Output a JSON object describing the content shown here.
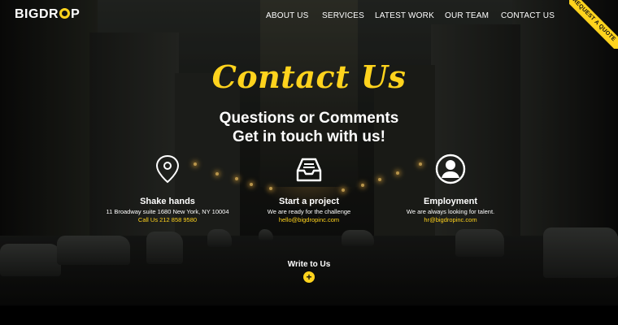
{
  "header": {
    "logo_text_a": "BIGDR",
    "logo_text_b": "P",
    "nav": [
      "ABOUT US",
      "SERVICES",
      "LATEST WORK",
      "OUR TEAM",
      "CONTACT US"
    ],
    "ribbon_label": "REQUEST A QUOTE"
  },
  "hero": {
    "title": "Contact Us",
    "subtitle_line1": "Questions or Comments",
    "subtitle_line2": "Get in touch with us!"
  },
  "columns": [
    {
      "icon": "map-pin-icon",
      "title": "Shake hands",
      "line1": "11 Broadway suite 1680 New York, NY 10004",
      "line2": "Call Us 212 858 9580"
    },
    {
      "icon": "inbox-tray-icon",
      "title": "Start a project",
      "line1": "We are ready for the challenge",
      "line2": "hello@bigdropinc.com"
    },
    {
      "icon": "user-avatar-icon",
      "title": "Employment",
      "line1": "We are always looking for talent.",
      "line2": "hr@bigdropinc.com"
    }
  ],
  "cta": {
    "label": "Write to Us",
    "button_icon": "plus-icon",
    "button_glyph": "+"
  },
  "colors": {
    "accent": "#ffd31d",
    "text": "#ffffff",
    "bottom_bar": "#000000"
  }
}
